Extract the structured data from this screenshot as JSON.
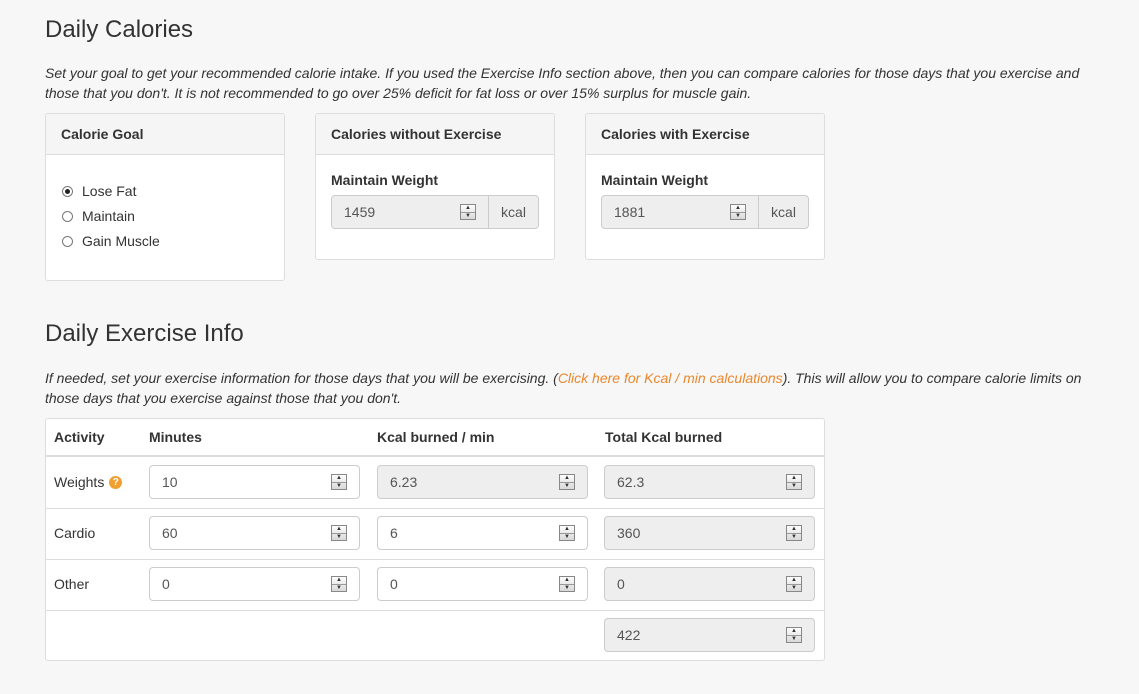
{
  "daily_calories": {
    "title": "Daily Calories",
    "description": "Set your goal to get your recommended calorie intake. If you used the Exercise Info section above, then you can compare calories for those days that you exercise and those that you don't. It is not recommended to go over 25% deficit for fat loss or over 15% surplus for muscle gain.",
    "calorie_goal": {
      "heading": "Calorie Goal",
      "options": [
        "Lose Fat",
        "Maintain",
        "Gain Muscle"
      ],
      "selected": "Lose Fat"
    },
    "without_exercise": {
      "heading": "Calories without Exercise",
      "label": "Maintain Weight",
      "value": "1459",
      "unit": "kcal"
    },
    "with_exercise": {
      "heading": "Calories with Exercise",
      "label": "Maintain Weight",
      "value": "1881",
      "unit": "kcal"
    }
  },
  "daily_exercise": {
    "title": "Daily Exercise Info",
    "description_before": "If needed, set your exercise information for those days that you will be exercising. (",
    "link_text": "Click here for Kcal / min calculations",
    "description_after": "). This will allow you to compare calorie limits on those days that you exercise against those that you don't.",
    "columns": [
      "Activity",
      "Minutes",
      "Kcal burned / min",
      "Total Kcal burned"
    ],
    "rows": [
      {
        "activity": "Weights",
        "minutes": "10",
        "kcal_per_min": "6.23",
        "total": "62.3"
      },
      {
        "activity": "Cardio",
        "minutes": "60",
        "kcal_per_min": "6",
        "total": "360"
      },
      {
        "activity": "Other",
        "minutes": "0",
        "kcal_per_min": "0",
        "total": "0"
      }
    ],
    "grand_total": "422",
    "help_icon": "question-circle-icon",
    "accent_color": "#e8882e"
  }
}
